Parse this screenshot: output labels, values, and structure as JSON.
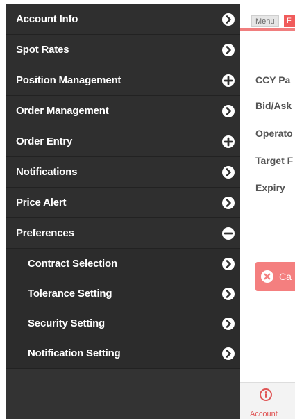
{
  "side_menu": {
    "items": [
      {
        "label": "Account Info",
        "icon": "chevron-right-icon"
      },
      {
        "label": "Spot Rates",
        "icon": "chevron-right-icon"
      },
      {
        "label": "Position Management",
        "icon": "plus-icon"
      },
      {
        "label": "Order Management",
        "icon": "chevron-right-icon"
      },
      {
        "label": "Order Entry",
        "icon": "plus-icon"
      },
      {
        "label": "Notifications",
        "icon": "chevron-right-icon"
      },
      {
        "label": "Price Alert",
        "icon": "chevron-right-icon"
      },
      {
        "label": "Preferences",
        "icon": "minus-icon"
      }
    ],
    "sub_items": [
      {
        "label": "Contract Selection",
        "icon": "chevron-right-icon"
      },
      {
        "label": "Tolerance Setting",
        "icon": "chevron-right-icon"
      },
      {
        "label": "Security Setting",
        "icon": "chevron-right-icon"
      },
      {
        "label": "Notification Setting",
        "icon": "chevron-right-icon"
      }
    ]
  },
  "header": {
    "menu_label": "Menu",
    "red_label": "F"
  },
  "form": {
    "labels": [
      "CCY Pa",
      "Bid/Ask",
      "Operato",
      "Target F",
      "Expiry"
    ]
  },
  "actions": {
    "cancel_label": "Ca"
  },
  "bottom_bar": {
    "account_label": "Account"
  },
  "colors": {
    "menu_bg": "#2f2f2f",
    "accent": "#f07e7e",
    "cancel": "#f47f7f"
  }
}
